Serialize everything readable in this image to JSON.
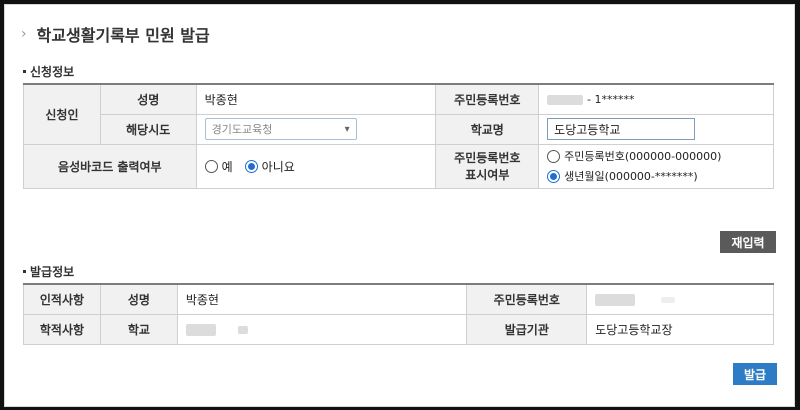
{
  "page": {
    "title": "학교생활기록부 민원 발급"
  },
  "application": {
    "section_title": "신청정보",
    "applicant_label": "신청인",
    "name_label": "성명",
    "name_value": "박종현",
    "rrn_label": "주민등록번호",
    "rrn_suffix": "- 1******",
    "region_label": "해당시도",
    "region_value": "경기도교육청",
    "school_label": "학교명",
    "school_value": "도당고등학교",
    "barcode_label": "음성바코드 출력여부",
    "barcode_options": [
      "예",
      "아니요"
    ],
    "barcode_selected": "아니요",
    "rrn_display_label_1": "주민등록번호",
    "rrn_display_label_2": "표시여부",
    "rrn_display_options": [
      "주민등록번호(000000-000000)",
      "생년월일(000000-*******)"
    ],
    "rrn_display_selected": "생년월일(000000-*******)"
  },
  "buttons": {
    "reset": "재입력",
    "issue": "발급"
  },
  "issuance": {
    "section_title": "발급정보",
    "personal_label": "인적사항",
    "name_label": "성명",
    "name_value": "박종현",
    "rrn_label": "주민등록번호",
    "academic_label": "학적사항",
    "school_label": "학교",
    "issuer_label": "발급기관",
    "issuer_value": "도당고등학교장"
  }
}
